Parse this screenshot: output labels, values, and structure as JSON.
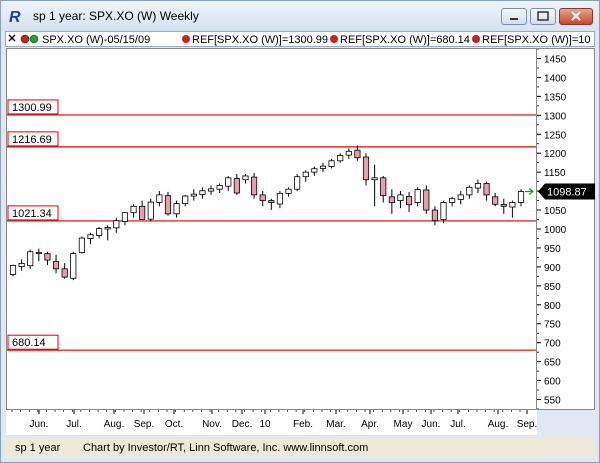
{
  "window": {
    "title": "sp 1 year: SPX.XO (W) Weekly",
    "minimize_label": "minimize",
    "maximize_label": "maximize",
    "close_label": "close"
  },
  "info_bar": {
    "symbol_label": "SPX.XO (W)-05/15/09",
    "ref_labels": [
      "REF[SPX.XO (W)]=1300.99",
      "REF[SPX.XO (W)]=680.14",
      "REF[SPX.XO (W)]=10"
    ]
  },
  "status_bar": {
    "left": "sp 1 year",
    "credit": "Chart by Investor/RT, Linn Software, Inc. www.linnsoft.com"
  },
  "colors": {
    "up_candle": "#ffffff",
    "down_candle": "#e8a0a8",
    "candle_stroke": "#000000",
    "ref_line": "#e00000",
    "price_marker": "#000000",
    "arrow_green": "#18a018"
  },
  "chart_data": {
    "type": "candlestick",
    "ylim": [
      525,
      1475
    ],
    "y_ticks": [
      550,
      600,
      650,
      700,
      750,
      800,
      850,
      900,
      950,
      1000,
      1050,
      1100,
      1150,
      1200,
      1250,
      1300,
      1350,
      1400,
      1450
    ],
    "x_ticks": [
      "Jun.",
      "Jul.",
      "Aug.",
      "Sep.",
      "Oct.",
      "Nov.",
      "Dec.",
      "10",
      "Feb.",
      "Mar.",
      "Apr.",
      "May",
      "Jun.",
      "Jul.",
      "Aug.",
      "Sep."
    ],
    "reference_lines": [
      {
        "label": "1300.99",
        "value": 1300.99
      },
      {
        "label": "1216.69",
        "value": 1216.69
      },
      {
        "label": "1021.34",
        "value": 1021.34
      },
      {
        "label": "680.14",
        "value": 680.14
      }
    ],
    "last_price": {
      "label": "1098.87",
      "value": 1098.87
    },
    "candles": [
      {
        "o": 880,
        "h": 906,
        "l": 875,
        "c": 904
      },
      {
        "o": 901,
        "h": 920,
        "l": 890,
        "c": 909
      },
      {
        "o": 903,
        "h": 946,
        "l": 895,
        "c": 940
      },
      {
        "o": 935,
        "h": 948,
        "l": 915,
        "c": 938
      },
      {
        "o": 935,
        "h": 940,
        "l": 905,
        "c": 918
      },
      {
        "o": 914,
        "h": 932,
        "l": 883,
        "c": 895
      },
      {
        "o": 895,
        "h": 910,
        "l": 869,
        "c": 873
      },
      {
        "o": 870,
        "h": 940,
        "l": 865,
        "c": 935
      },
      {
        "o": 938,
        "h": 980,
        "l": 935,
        "c": 976
      },
      {
        "o": 975,
        "h": 990,
        "l": 960,
        "c": 985
      },
      {
        "o": 983,
        "h": 1005,
        "l": 975,
        "c": 1001
      },
      {
        "o": 1000,
        "h": 1010,
        "l": 970,
        "c": 1004
      },
      {
        "o": 1003,
        "h": 1030,
        "l": 990,
        "c": 1022
      },
      {
        "o": 1020,
        "h": 1045,
        "l": 1010,
        "c": 1043
      },
      {
        "o": 1043,
        "h": 1065,
        "l": 1030,
        "c": 1060
      },
      {
        "o": 1060,
        "h": 1075,
        "l": 1025,
        "c": 1025
      },
      {
        "o": 1026,
        "h": 1080,
        "l": 1020,
        "c": 1071
      },
      {
        "o": 1070,
        "h": 1100,
        "l": 1060,
        "c": 1090
      },
      {
        "o": 1088,
        "h": 1098,
        "l": 1035,
        "c": 1040
      },
      {
        "o": 1040,
        "h": 1075,
        "l": 1030,
        "c": 1067
      },
      {
        "o": 1067,
        "h": 1090,
        "l": 1060,
        "c": 1087
      },
      {
        "o": 1087,
        "h": 1105,
        "l": 1075,
        "c": 1092
      },
      {
        "o": 1091,
        "h": 1110,
        "l": 1080,
        "c": 1101
      },
      {
        "o": 1100,
        "h": 1115,
        "l": 1090,
        "c": 1106
      },
      {
        "o": 1105,
        "h": 1120,
        "l": 1095,
        "c": 1115
      },
      {
        "o": 1113,
        "h": 1140,
        "l": 1100,
        "c": 1135
      },
      {
        "o": 1133,
        "h": 1145,
        "l": 1090,
        "c": 1095
      },
      {
        "o": 1130,
        "h": 1145,
        "l": 1120,
        "c": 1140
      },
      {
        "o": 1137,
        "h": 1148,
        "l": 1080,
        "c": 1090
      },
      {
        "o": 1090,
        "h": 1100,
        "l": 1060,
        "c": 1075
      },
      {
        "o": 1075,
        "h": 1080,
        "l": 1050,
        "c": 1070
      },
      {
        "o": 1066,
        "h": 1100,
        "l": 1055,
        "c": 1094
      },
      {
        "o": 1094,
        "h": 1110,
        "l": 1085,
        "c": 1105
      },
      {
        "o": 1105,
        "h": 1145,
        "l": 1100,
        "c": 1138
      },
      {
        "o": 1138,
        "h": 1155,
        "l": 1125,
        "c": 1150
      },
      {
        "o": 1150,
        "h": 1165,
        "l": 1140,
        "c": 1159
      },
      {
        "o": 1160,
        "h": 1175,
        "l": 1150,
        "c": 1166
      },
      {
        "o": 1165,
        "h": 1185,
        "l": 1160,
        "c": 1180
      },
      {
        "o": 1180,
        "h": 1200,
        "l": 1175,
        "c": 1194
      },
      {
        "o": 1195,
        "h": 1213,
        "l": 1185,
        "c": 1205
      },
      {
        "o": 1208,
        "h": 1220,
        "l": 1180,
        "c": 1188
      },
      {
        "o": 1190,
        "h": 1200,
        "l": 1115,
        "c": 1130
      },
      {
        "o": 1130,
        "h": 1170,
        "l": 1060,
        "c": 1135
      },
      {
        "o": 1135,
        "h": 1140,
        "l": 1070,
        "c": 1088
      },
      {
        "o": 1085,
        "h": 1105,
        "l": 1040,
        "c": 1070
      },
      {
        "o": 1075,
        "h": 1100,
        "l": 1055,
        "c": 1090
      },
      {
        "o": 1086,
        "h": 1098,
        "l": 1045,
        "c": 1064
      },
      {
        "o": 1070,
        "h": 1110,
        "l": 1060,
        "c": 1104
      },
      {
        "o": 1103,
        "h": 1115,
        "l": 1040,
        "c": 1050
      },
      {
        "o": 1050,
        "h": 1060,
        "l": 1010,
        "c": 1022
      },
      {
        "o": 1025,
        "h": 1075,
        "l": 1015,
        "c": 1070
      },
      {
        "o": 1070,
        "h": 1085,
        "l": 1060,
        "c": 1080
      },
      {
        "o": 1078,
        "h": 1100,
        "l": 1065,
        "c": 1090
      },
      {
        "o": 1090,
        "h": 1115,
        "l": 1080,
        "c": 1110
      },
      {
        "o": 1108,
        "h": 1130,
        "l": 1095,
        "c": 1120
      },
      {
        "o": 1120,
        "h": 1125,
        "l": 1075,
        "c": 1090
      },
      {
        "o": 1085,
        "h": 1095,
        "l": 1060,
        "c": 1065
      },
      {
        "o": 1065,
        "h": 1080,
        "l": 1040,
        "c": 1060
      },
      {
        "o": 1058,
        "h": 1075,
        "l": 1030,
        "c": 1070
      },
      {
        "o": 1070,
        "h": 1105,
        "l": 1060,
        "c": 1099
      }
    ]
  }
}
